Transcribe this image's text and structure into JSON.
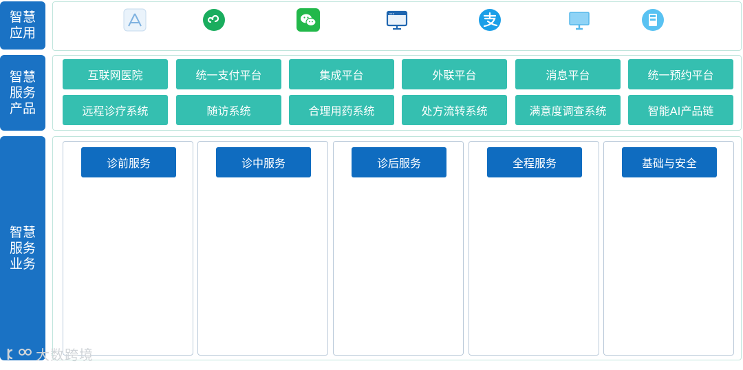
{
  "sections": {
    "apps": {
      "label": "智慧\n应用"
    },
    "products": {
      "label": "智慧\n服务\n产品"
    },
    "business": {
      "label": "智慧\n服务\n业务"
    }
  },
  "apps": [
    {
      "icon": "app-store-icon"
    },
    {
      "icon": "mini-program-icon"
    },
    {
      "icon": "wechat-icon"
    },
    {
      "icon": "web-browser-icon"
    },
    {
      "icon": "alipay-icon"
    },
    {
      "icon": "desktop-monitor-icon"
    },
    {
      "icon": "kiosk-terminal-icon"
    }
  ],
  "products": [
    [
      "互联网医院",
      "统一支付平台",
      "集成平台",
      "外联平台",
      "消息平台",
      "统一预约平台"
    ],
    [
      "远程诊疗系统",
      "随访系统",
      "合理用药系统",
      "处方流转系统",
      "满意度调查系统",
      "智能AI产品链"
    ]
  ],
  "business_columns": [
    "诊前服务",
    "诊中服务",
    "诊后服务",
    "全程服务",
    "基础与安全"
  ],
  "watermark": "大数跨境",
  "colors": {
    "section_blue": "#1a72c4",
    "product_teal": "#35bfb0",
    "column_header_blue": "#0f6cc0"
  }
}
